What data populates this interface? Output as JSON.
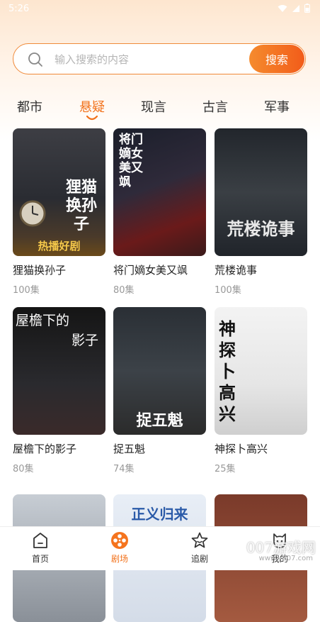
{
  "status": {
    "time": "5:26"
  },
  "search": {
    "placeholder": "输入搜索的内容",
    "button": "搜索"
  },
  "tabs": [
    {
      "label": "都市"
    },
    {
      "label": "悬疑",
      "active": true
    },
    {
      "label": "现言"
    },
    {
      "label": "古言"
    },
    {
      "label": "军事"
    }
  ],
  "dramas": [
    {
      "title": "狸猫换孙子",
      "count": "100集",
      "poster_text": "狸猫换孙子",
      "poster_sub": "热播好剧"
    },
    {
      "title": "将门嫡女美又飒",
      "count": "80集",
      "poster_text": "将门嫡女美又飒"
    },
    {
      "title": "荒楼诡事",
      "count": "100集",
      "poster_text": "荒楼诡事"
    },
    {
      "title": "屋檐下的影子",
      "count": "80集",
      "poster_text_1": "屋檐下的",
      "poster_text_2": "影子"
    },
    {
      "title": "捉五魁",
      "count": "74集",
      "poster_text": "捉五魁"
    },
    {
      "title": "神探卜高兴",
      "count": "25集",
      "poster_text": "神探卜高兴"
    },
    {
      "poster_text": ""
    },
    {
      "poster_text": "正义归来"
    },
    {
      "poster_text": ""
    }
  ],
  "bottom_nav": [
    {
      "label": "首页",
      "icon": "home-icon"
    },
    {
      "label": "剧场",
      "icon": "film-reel-icon",
      "active": true
    },
    {
      "label": "追剧",
      "icon": "star-icon"
    },
    {
      "label": "我的",
      "icon": "profile-icon"
    }
  ],
  "watermark": {
    "text": "007游戏网",
    "url": "www.y007.com"
  },
  "colors": {
    "accent": "#f2721c",
    "search_border": "#f08a3a"
  }
}
